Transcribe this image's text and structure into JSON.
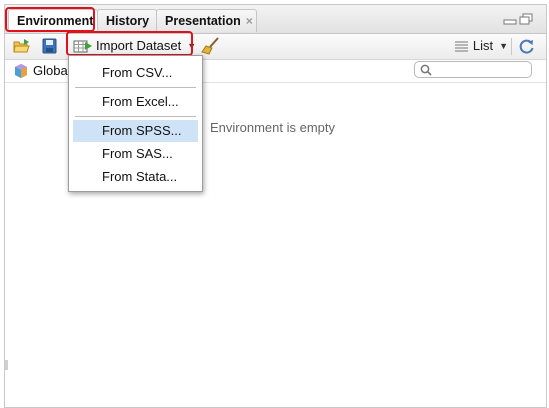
{
  "tabs": {
    "environment": "Environment",
    "history": "History",
    "presentation": "Presentation",
    "close_glyph": "×"
  },
  "toolbar": {
    "import_label": "Import Dataset",
    "list_label": "List"
  },
  "envrow": {
    "global_label": "Global"
  },
  "main": {
    "empty_message": "Environment is empty"
  },
  "menu": {
    "items": [
      "From CSV...",
      "From Excel...",
      "From SPSS...",
      "From SAS...",
      "From Stata..."
    ],
    "highlighted": "From SPSS..."
  },
  "colors": {
    "highlight": "#e0101c",
    "menu_hover": "#cfe3f7"
  }
}
